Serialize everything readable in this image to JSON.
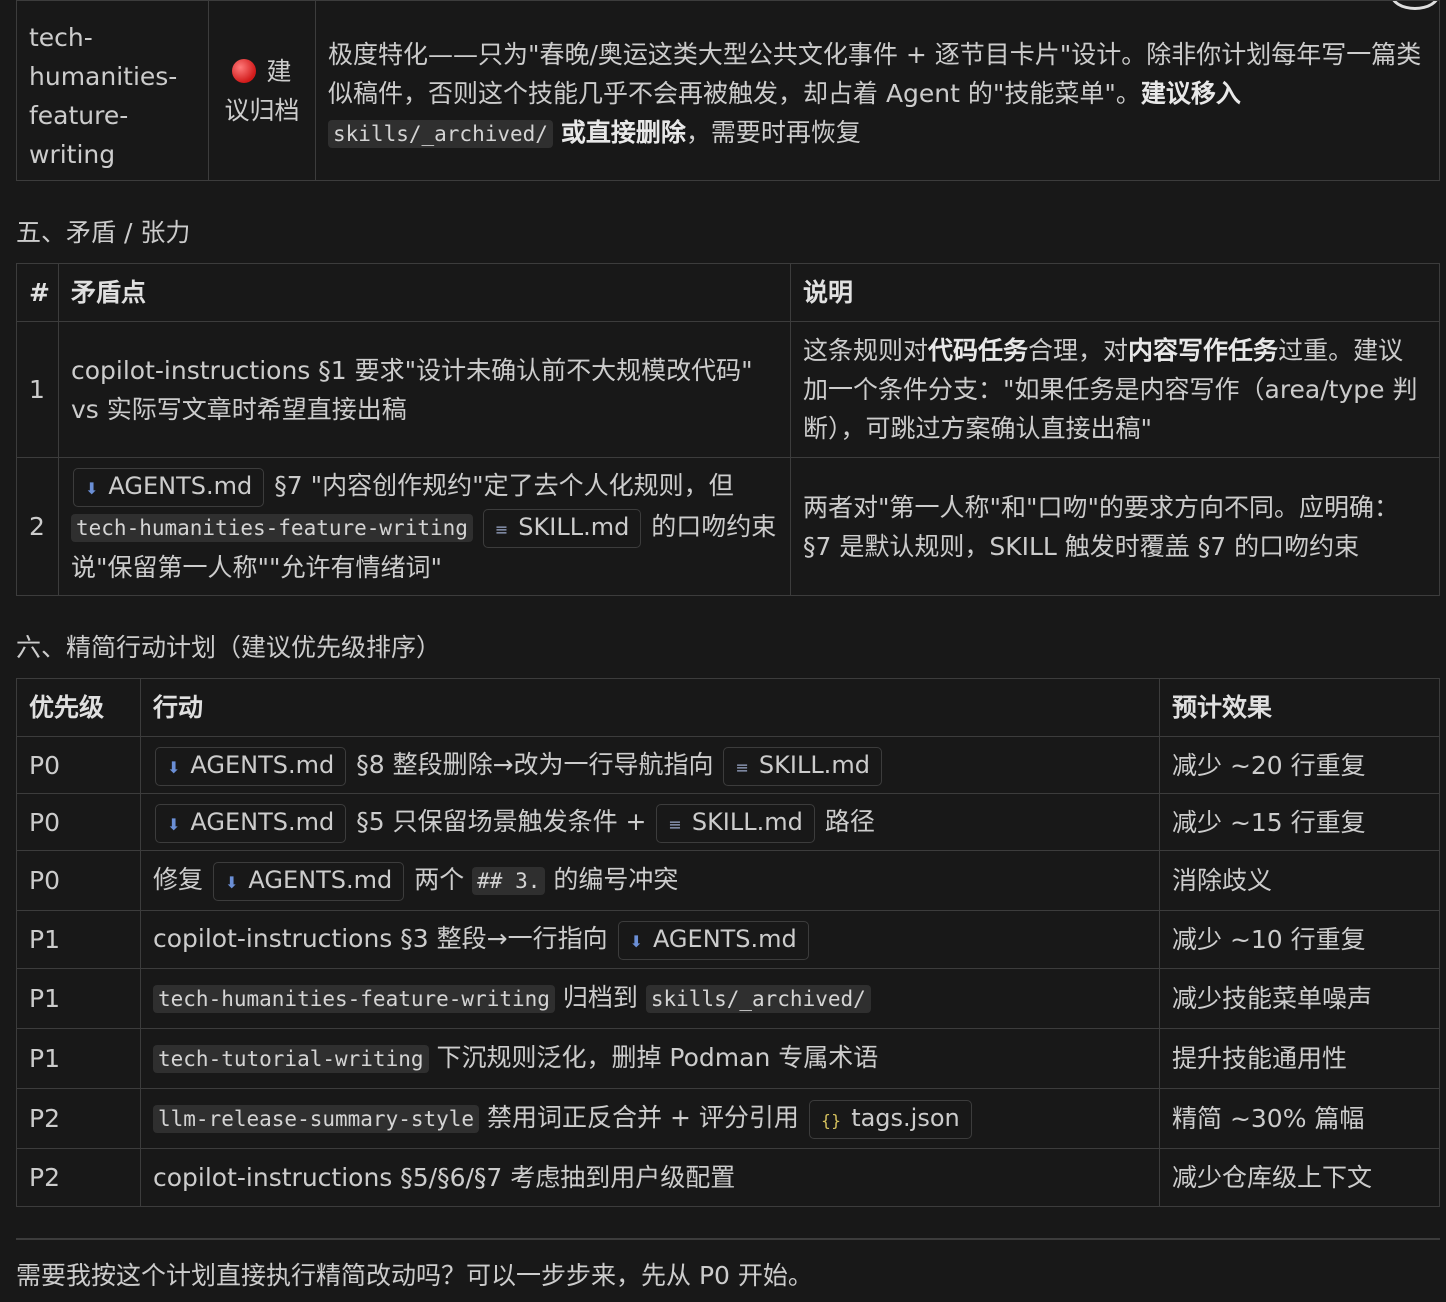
{
  "archive_row": {
    "skill": "tech-humanities-feature-writing",
    "status_icon": "red-circle",
    "status": "建议归档",
    "desc_pre": "极度特化——只为\"春晚/奥运这类大型公共文化事件 + 逐节目卡片\"设计。除非你计划每年写一篇类似稿件，否则这个技能几乎不会再被触发，却占着 Agent 的\"技能菜单\"。",
    "desc_bold1": "建议移入",
    "desc_code": "skills/_archived/",
    "desc_bold2": "或直接删除",
    "desc_post": "，需要时再恢复"
  },
  "section5": {
    "title": "五、矛盾 / 张力",
    "headers": [
      "#",
      "矛盾点",
      "说明"
    ],
    "rows": [
      {
        "num": "1",
        "point": "copilot-instructions §1 要求\"设计未确认前不大规模改代码\" vs 实际写文章时希望直接出稿",
        "note_a": "这条规则对",
        "note_b1": "代码任务",
        "note_c": "合理，对",
        "note_b2": "内容写作任务",
        "note_d": "过重。建议加一个条件分支：\"如果任务是内容写作（area/type 判断），可跳过方案确认直接出稿\""
      },
      {
        "num": "2",
        "file1": "AGENTS.md",
        "text1": "§7 \"内容创作规约\"定了去个人化规则，但",
        "code1": "tech-humanities-feature-writing",
        "file2": "SKILL.md",
        "text2": "的口吻约束说\"保留第一人称\"\"允许有情绪词\"",
        "note": "两者对\"第一人称\"和\"口吻\"的要求方向不同。应明确：§7 是默认规则，SKILL 触发时覆盖 §7 的口吻约束"
      }
    ]
  },
  "section6": {
    "title": "六、精简行动计划（建议优先级排序）",
    "headers": [
      "优先级",
      "行动",
      "预计效果"
    ],
    "rows": [
      {
        "priority": "P0",
        "f1": "AGENTS.md",
        "t1": "§8 整段删除→改为一行导航指向",
        "f2": "SKILL.md",
        "effect": "减少 ~20 行重复"
      },
      {
        "priority": "P0",
        "f1": "AGENTS.md",
        "t1": "§5 只保留场景触发条件 +",
        "f2": "SKILL.md",
        "t2": "路径",
        "effect": "减少 ~15 行重复"
      },
      {
        "priority": "P0",
        "t0": "修复",
        "f1": "AGENTS.md",
        "t1": "两个",
        "c1": "## 3.",
        "t2": "的编号冲突",
        "effect": "消除歧义"
      },
      {
        "priority": "P1",
        "t0": "copilot-instructions §3 整段→一行指向",
        "f1": "AGENTS.md",
        "effect": "减少 ~10 行重复"
      },
      {
        "priority": "P1",
        "c1": "tech-humanities-feature-writing",
        "t1": "归档到",
        "c2": "skills/_archived/",
        "effect": "减少技能菜单噪声"
      },
      {
        "priority": "P1",
        "c1": "tech-tutorial-writing",
        "t1": "下沉规则泛化，删掉 Podman 专属术语",
        "effect": "提升技能通用性"
      },
      {
        "priority": "P2",
        "c1": "llm-release-summary-style",
        "t1": "禁用词正反合并 + 评分引用",
        "f1": "tags.json",
        "effect": "精简 ~30% 篇幅"
      },
      {
        "priority": "P2",
        "t0": "copilot-instructions §5/§6/§7 考虑抽到用户级配置",
        "effect": "减少仓库级上下文"
      }
    ]
  },
  "footer": "需要我按这个计划直接执行精简改动吗？可以一步步来，先从 P0 开始。"
}
